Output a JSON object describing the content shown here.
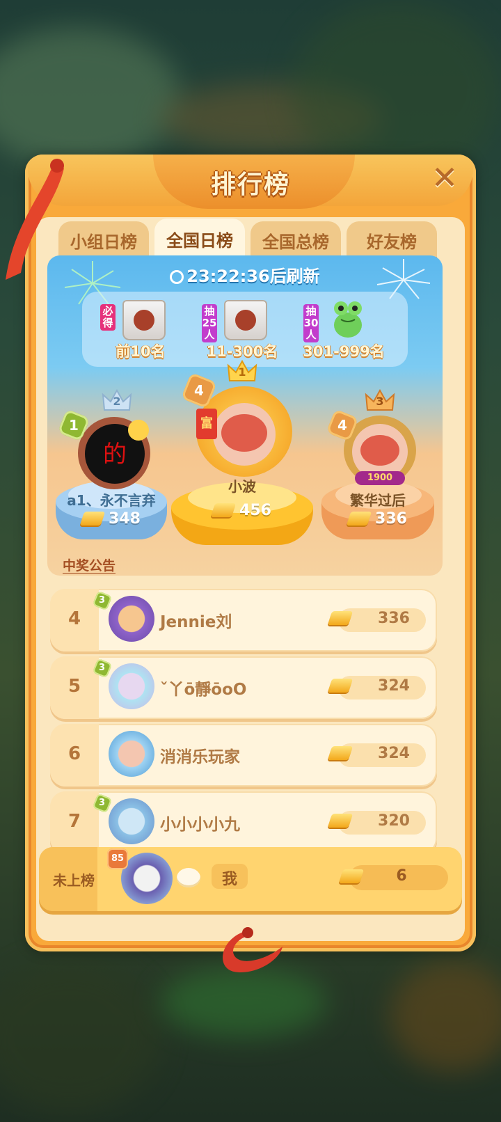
{
  "dialog": {
    "title": "排行榜",
    "close_icon": "close-icon"
  },
  "tabs": [
    {
      "label": "小组日榜",
      "active": false
    },
    {
      "label": "全国日榜",
      "active": true
    },
    {
      "label": "全国总榜",
      "active": false
    },
    {
      "label": "好友榜",
      "active": false
    }
  ],
  "board": {
    "refresh": "23:22:36后刷新",
    "rewards": [
      {
        "tag": "必得",
        "label": "前10名",
        "icon": "tote-bag-icon"
      },
      {
        "tag": "抽25人",
        "label": "11-300名",
        "icon": "tote-bag-icon"
      },
      {
        "tag": "抽30人",
        "label": "301-999名",
        "icon": "frog-toy-icon"
      }
    ],
    "podium": {
      "first": {
        "rank": "1",
        "level": "4",
        "name": "小波",
        "score": "456"
      },
      "second": {
        "rank": "2",
        "level": "1",
        "name": "a1、永不言弃",
        "score": "348"
      },
      "third": {
        "rank": "3",
        "level": "4",
        "name": "繁华过后",
        "score": "336",
        "frame_badge": "1900"
      }
    },
    "avatar_text_2": "的"
  },
  "announcement": "中奖公告",
  "rows": [
    {
      "rank": "4",
      "level": "3",
      "name": "Jennie刘",
      "score": "336"
    },
    {
      "rank": "5",
      "level": "3",
      "name": "ˇ丫ō靜ōoO",
      "score": "324"
    },
    {
      "rank": "6",
      "level": "",
      "name": "消消乐玩家",
      "score": "324"
    },
    {
      "rank": "7",
      "level": "3",
      "name": "小小小小九",
      "score": "320"
    }
  ],
  "me": {
    "rank": "未上榜",
    "level": "85",
    "name": "我",
    "score": "6"
  },
  "colors": {
    "panel": "#f9a93a",
    "inner": "#fbe7bf",
    "accent_text": "#b07a45"
  }
}
